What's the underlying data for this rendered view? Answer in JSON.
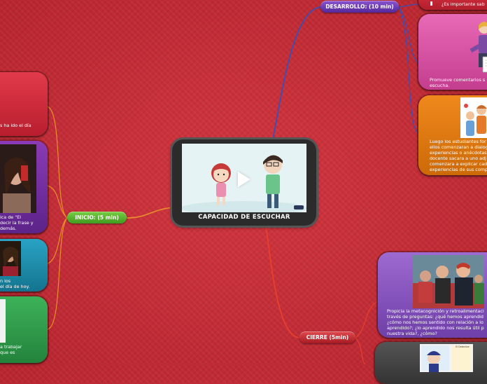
{
  "center": {
    "title": "CAPACIDAD DE ESCUCHAR",
    "icon": "play-icon"
  },
  "branches": {
    "inicio": {
      "label": "INICIO: (5 min)",
      "color": "#5cb531"
    },
    "desarrollo": {
      "label": "DESARROLLO: (10 min)",
      "color": "#6a3bb0"
    },
    "cierre": {
      "label": "CIERRE (5min)",
      "color": "#c8262e"
    }
  },
  "inicio_cards": [
    {
      "text": "s ha ido el día"
    },
    {
      "text": "ica de \"El\ndecir la frase y\ndemás."
    },
    {
      "text": "n los\nel día de hoy."
    },
    {
      "text": "a trabajar\nque es"
    }
  ],
  "desarrollo_cards": [
    {
      "text": "¿Es importante sab"
    },
    {
      "text": "Promueve comentarios s\nescucha."
    },
    {
      "text": "Luego los estudiantes for\nellos comenzaran a dialog\nexperiencias o anécdotas\ndocente sacara a uno adj\ncomenzara a explicar cad\nexperiencias de sus comp"
    }
  ],
  "cierre_cards": [
    {
      "text": "Propicia la metacognición y retroalimentaci\ntravés de preguntas: ¿qué hemos aprendid\n¿cómo nos hemos sentido con relación a lo\naprendido?; ¿lo aprendido nos resulta útil p\nnuestra vida?, ¿cómo?"
    },
    {
      "text": "El Detective"
    }
  ],
  "colors": {
    "background": "#c62b35",
    "inicio_line": "#e8912a",
    "desarrollo_line": "#3a4fb5",
    "cierre_line": "#e8402a"
  }
}
